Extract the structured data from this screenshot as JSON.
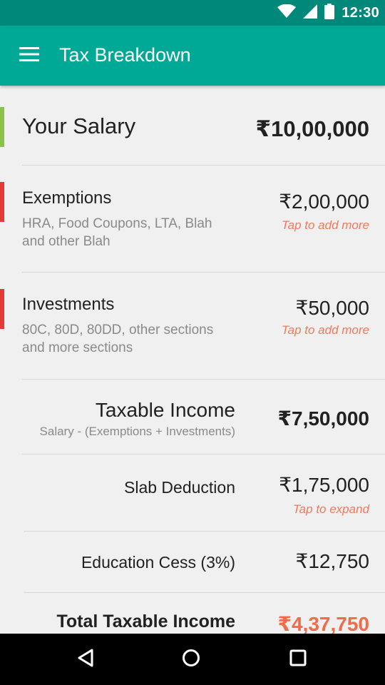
{
  "status_bar": {
    "time": "12:30",
    "icons": [
      "wifi-icon",
      "cellular-signal-icon",
      "battery-icon"
    ]
  },
  "toolbar": {
    "title": "Tax Breakdown",
    "menu_icon": "hamburger-menu-icon"
  },
  "colors": {
    "status_bar": "#00897b",
    "toolbar": "#00a896",
    "salary_indicator": "#8bc34a",
    "deduction_indicator": "#e53935",
    "tap_hint": "#ef7a5b",
    "total_amount": "#ef6c4a"
  },
  "salary": {
    "label": "Your Salary",
    "amount": "₹10,00,000"
  },
  "exemptions": {
    "label": "Exemptions",
    "description": "HRA, Food Coupons, LTA, Blah and other Blah",
    "amount": "₹2,00,000",
    "hint": "Tap to add more"
  },
  "investments": {
    "label": "Investments",
    "description": "80C, 80D, 80DD, other sections and more sections",
    "amount": "₹50,000",
    "hint": "Tap to add more"
  },
  "taxable_income": {
    "label": "Taxable Income",
    "formula": "Salary - (Exemptions + Investments)",
    "amount": "₹7,50,000"
  },
  "slab_deduction": {
    "label": "Slab Deduction",
    "amount": "₹1,75,000",
    "hint": "Tap to expand"
  },
  "education_cess": {
    "label": "Education Cess (3%)",
    "amount": "₹12,750"
  },
  "total_taxable_income": {
    "label": "Total Taxable Income",
    "amount": "₹4,37,750"
  },
  "nav_bar": {
    "buttons": [
      "back-icon",
      "home-icon",
      "recents-icon"
    ]
  }
}
